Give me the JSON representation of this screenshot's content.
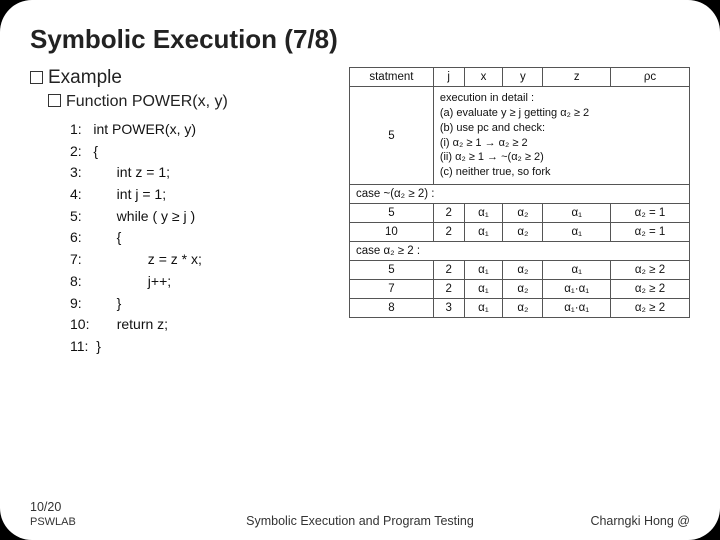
{
  "title": "Symbolic Execution (7/8)",
  "bullets": {
    "example": "Example",
    "func": "Function POWER(x, y)"
  },
  "code": "1:   int POWER(x, y)\n2:   {\n3:         int z = 1;\n4:         int j = 1;\n5:         while ( y ≥ j )\n6:         {\n7:                 z = z * x;\n8:                 j++;\n9:         }\n10:       return z;\n11:  }",
  "table": {
    "headers": {
      "stmt": "statment",
      "j": "j",
      "x": "x",
      "y": "y",
      "z": "z",
      "pc": "ρc"
    },
    "detailRow": {
      "stmt": "5",
      "text": "execution in detail :\n(a) evaluate y ≥ j getting  α₂ ≥ 2\n(b) use pc and check:\n    (i) α₂ ≥ 1 → α₂ ≥ 2\n    (ii) α₂ ≥ 1 → ~(α₂ ≥ 2)\n(c) neither true, so fork"
    },
    "case1Label": "case ~(α₂ ≥ 2) :",
    "case1Rows": [
      {
        "stmt": "5",
        "j": "2",
        "x": "α₁",
        "y": "α₂",
        "z": "α₁",
        "pc": "α₂ = 1"
      },
      {
        "stmt": "10",
        "j": "2",
        "x": "α₁",
        "y": "α₂",
        "z": "α₁",
        "pc": "α₂ = 1"
      }
    ],
    "case2Label": "case α₂ ≥ 2 :",
    "case2Rows": [
      {
        "stmt": "5",
        "j": "2",
        "x": "α₁",
        "y": "α₂",
        "z": "α₁",
        "pc": "α₂ ≥ 2"
      },
      {
        "stmt": "7",
        "j": "2",
        "x": "α₁",
        "y": "α₂",
        "z": "α₁·α₁",
        "pc": "α₂ ≥ 2"
      },
      {
        "stmt": "8",
        "j": "3",
        "x": "α₁",
        "y": "α₂",
        "z": "α₁·α₁",
        "pc": "α₂ ≥ 2"
      }
    ]
  },
  "footer": {
    "page": "10/20",
    "lab": "PSWLAB",
    "center": "Symbolic Execution and Program Testing",
    "author": "Charngki Hong @"
  }
}
